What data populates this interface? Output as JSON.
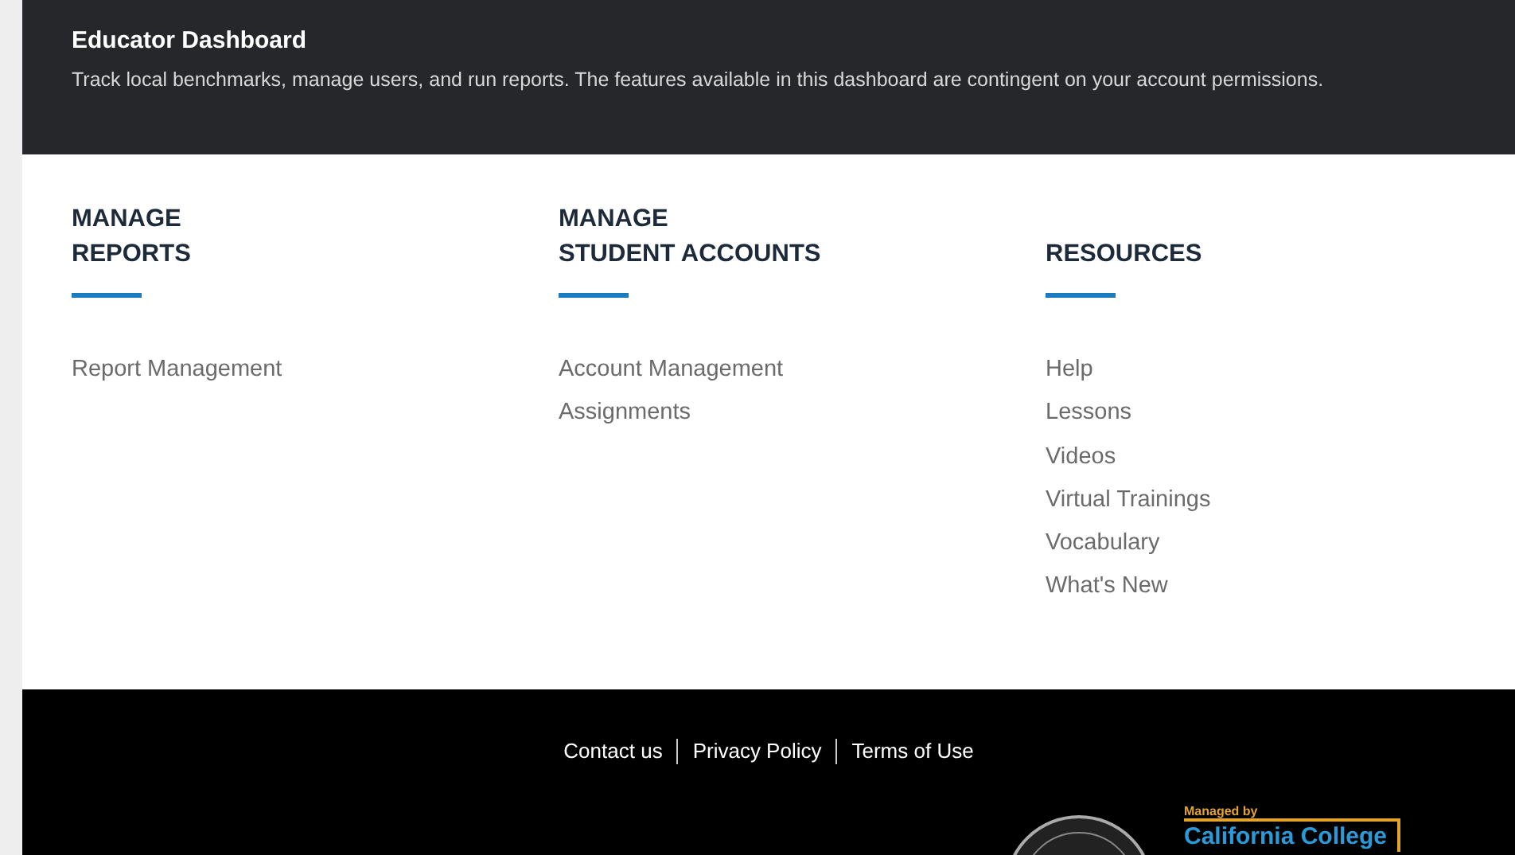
{
  "header": {
    "title": "Educator Dashboard",
    "description": "Track local benchmarks, manage users, and run reports. The features available in this dashboard are contingent on your account permissions."
  },
  "sections": [
    {
      "heading": [
        "MANAGE",
        "REPORTS"
      ],
      "links": [
        "Report Management"
      ]
    },
    {
      "heading": [
        "MANAGE",
        "STUDENT ACCOUNTS"
      ],
      "links": [
        "Account Management",
        "Assignments"
      ]
    },
    {
      "heading": [
        "RESOURCES"
      ],
      "links": [
        "Help",
        "Lessons",
        "Videos",
        "Virtual Trainings",
        "Vocabulary",
        "What's New"
      ]
    }
  ],
  "footer": {
    "links": [
      "Contact us",
      "Privacy Policy",
      "Terms of Use"
    ],
    "managed_by": "Managed by",
    "org": "California College"
  }
}
